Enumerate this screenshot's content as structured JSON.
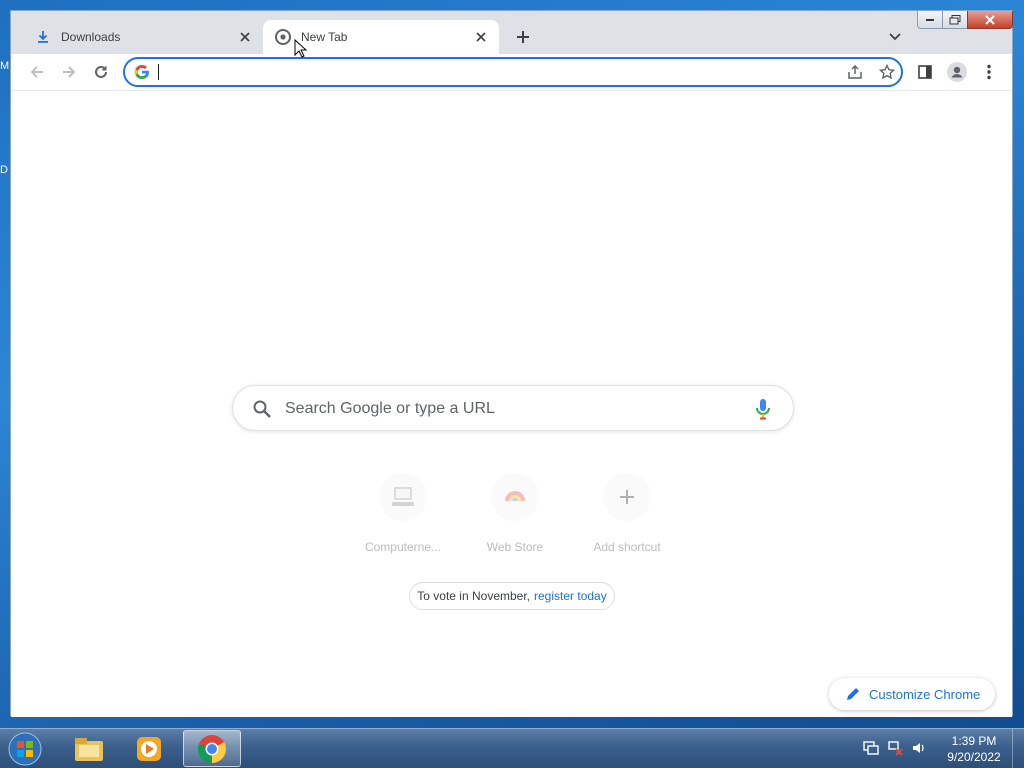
{
  "desktop": {
    "edge_letters": [
      "M",
      "D"
    ]
  },
  "browser": {
    "tabs": [
      {
        "title": "Downloads",
        "icon": "download-icon",
        "active": false
      },
      {
        "title": "New Tab",
        "icon": "chrome-icon",
        "active": true
      }
    ],
    "omnibox": {
      "value": "",
      "placeholder": ""
    },
    "ntp": {
      "search_placeholder": "Search Google or type a URL",
      "shortcuts": [
        {
          "label": "Computerne...",
          "icon": "computer-icon"
        },
        {
          "label": "Web Store",
          "icon": "webstore-icon"
        },
        {
          "label": "Add shortcut",
          "icon": "plus-icon"
        }
      ],
      "promo": {
        "text": "To vote in November,",
        "link": "register today"
      },
      "customize_label": "Customize Chrome"
    }
  },
  "taskbar": {
    "clock_time": "1:39 PM",
    "clock_date": "9/20/2022",
    "apps": [
      "explorer-icon",
      "media-player-icon",
      "chrome-icon"
    ]
  },
  "colors": {
    "accent": "#1a73e8",
    "tabstrip": "#dee1e6"
  }
}
